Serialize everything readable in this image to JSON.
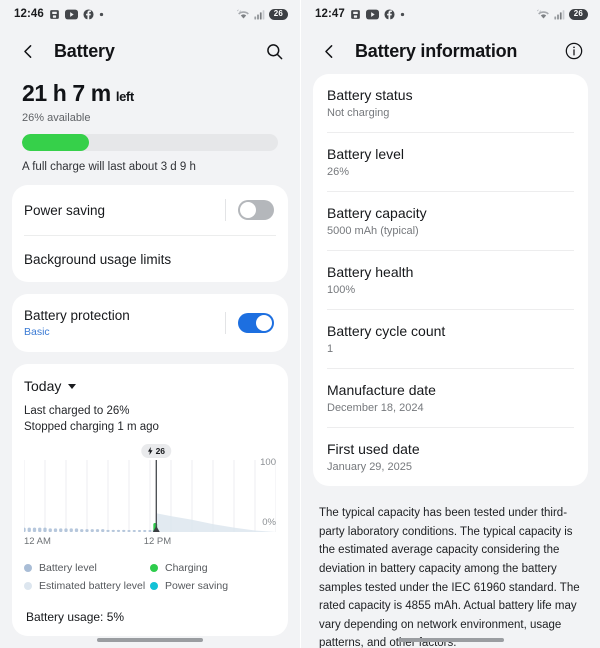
{
  "left": {
    "statusbar": {
      "time": "12:46",
      "icons": [
        "gallery-icon",
        "youtube-icon",
        "facebook-icon",
        "more-dot-icon"
      ],
      "right_icons": [
        "wifi-icon",
        "signal-icon"
      ],
      "battery_percent": "26"
    },
    "appbar": {
      "back": "back-icon",
      "title": "Battery",
      "action": "search-icon"
    },
    "summary": {
      "time_remaining": "21 h 7 m",
      "left_label": "left",
      "available": "26% available",
      "percent": 26,
      "full_charge": "A full charge will last about 3 d 9 h"
    },
    "settings": [
      {
        "label": "Power saving",
        "toggle": "off"
      },
      {
        "label": "Background usage limits",
        "toggle": null
      }
    ],
    "protection": {
      "label": "Battery protection",
      "sub": "Basic",
      "toggle": "on"
    },
    "chart_card": {
      "period": "Today",
      "last_charged": "Last charged to 26%",
      "stopped_charging": "Stopped charging 1 m ago",
      "marker_label": "26",
      "marker_icon": "charging-bolt-icon",
      "legend": [
        {
          "label": "Battery level",
          "color": "#a9bdd6"
        },
        {
          "label": "Charging",
          "color": "#2ecc4c"
        },
        {
          "label": "Estimated battery level",
          "color": "#dde6ef"
        },
        {
          "label": "Power saving",
          "color": "#12c2d6"
        }
      ],
      "usage_line": "Battery usage: 5%"
    }
  },
  "chart_data": {
    "type": "area",
    "title": "Today",
    "xlabel": "",
    "ylabel": "",
    "ylim": [
      0,
      100
    ],
    "ytick_labels": [
      "100",
      "0%"
    ],
    "xtick_labels": [
      "12 AM",
      "12 PM"
    ],
    "grid": true,
    "legend_position": "bottom",
    "now_marker": {
      "x_hour": 12.6,
      "value": 26,
      "label": "26"
    },
    "series": [
      {
        "name": "Battery level",
        "color": "#a9bdd6",
        "x": [
          0,
          0.5,
          1,
          1.5,
          2,
          2.5,
          3,
          3.5,
          4,
          4.5,
          5,
          5.5,
          6,
          6.5,
          7,
          7.5,
          8,
          8.5,
          9,
          9.5,
          10,
          10.5,
          11,
          11.5,
          12,
          12.4
        ],
        "values": [
          6,
          6,
          6,
          6,
          6,
          5,
          5,
          5,
          5,
          5,
          5,
          4,
          4,
          4,
          4,
          4,
          3,
          3,
          3,
          3,
          2,
          2,
          2,
          2,
          2,
          3
        ]
      },
      {
        "name": "Charging",
        "color": "#2ecc4c",
        "x": [
          12.5
        ],
        "values": [
          26
        ]
      },
      {
        "name": "Estimated battery level",
        "color": "#dde6ef",
        "x": [
          12.6,
          14,
          16,
          18,
          20,
          22,
          24
        ],
        "values": [
          26,
          22,
          17,
          11,
          6,
          2,
          0
        ]
      },
      {
        "name": "Power saving",
        "color": "#12c2d6",
        "x": [],
        "values": []
      }
    ]
  },
  "right": {
    "statusbar": {
      "time": "12:47",
      "icons": [
        "gallery-icon",
        "youtube-icon",
        "facebook-icon",
        "more-dot-icon"
      ],
      "right_icons": [
        "wifi-icon",
        "signal-icon"
      ],
      "battery_percent": "26"
    },
    "appbar": {
      "back": "back-icon",
      "title": "Battery information",
      "action": "info-icon"
    },
    "info_rows": [
      {
        "label": "Battery status",
        "value": "Not charging"
      },
      {
        "label": "Battery level",
        "value": "26%"
      },
      {
        "label": "Battery capacity",
        "value": "5000 mAh (typical)"
      },
      {
        "label": "Battery health",
        "value": "100%"
      },
      {
        "label": "Battery cycle count",
        "value": "1"
      },
      {
        "label": "Manufacture date",
        "value": "December 18, 2024"
      },
      {
        "label": "First used date",
        "value": "January 29, 2025"
      }
    ],
    "footnote": "The typical capacity has been tested under third-party laboratory conditions. The typical capacity is the estimated average capacity considering the deviation in battery capacity among the battery samples tested under the IEC 61960 standard. The rated capacity is 4855 mAh. Actual battery life may vary depending on network environment, usage patterns, and other factors."
  }
}
